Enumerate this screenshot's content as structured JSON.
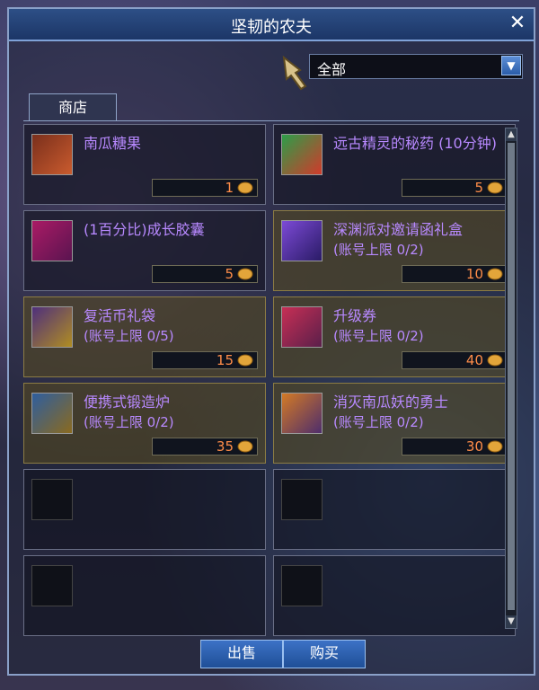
{
  "window": {
    "title": "坚韧的农夫"
  },
  "filter": {
    "value": "全部"
  },
  "tabs": [
    {
      "label": "商店"
    }
  ],
  "items": [
    {
      "name": "南瓜糖果",
      "limit": "",
      "price": "1",
      "style": "normal",
      "icon": "pumpkin-candy-icon"
    },
    {
      "name": "远古精灵的秘药 (10分钟)",
      "limit": "",
      "price": "5",
      "style": "normal",
      "icon": "elixir-icon"
    },
    {
      "name": "(1百分比)成长胶囊",
      "limit": "",
      "price": "5",
      "style": "normal",
      "icon": "capsule-icon"
    },
    {
      "name": "深渊派对邀请函礼盒",
      "limit": "(账号上限 0/2)",
      "price": "10",
      "style": "gold",
      "icon": "gift-box-icon"
    },
    {
      "name": "复活币礼袋",
      "limit": "(账号上限 0/5)",
      "price": "15",
      "style": "gold",
      "icon": "revive-coin-bag-icon"
    },
    {
      "name": "升级券",
      "limit": "(账号上限 0/2)",
      "price": "40",
      "style": "gold",
      "icon": "upgrade-ticket-icon"
    },
    {
      "name": "便携式锻造炉",
      "limit": "(账号上限 0/2)",
      "price": "35",
      "style": "gold",
      "icon": "forge-icon"
    },
    {
      "name": "消灭南瓜妖的勇士",
      "limit": "(账号上限 0/2)",
      "price": "30",
      "style": "gold",
      "icon": "warrior-icon"
    }
  ],
  "buttons": {
    "sell": "出售",
    "buy": "购买"
  }
}
